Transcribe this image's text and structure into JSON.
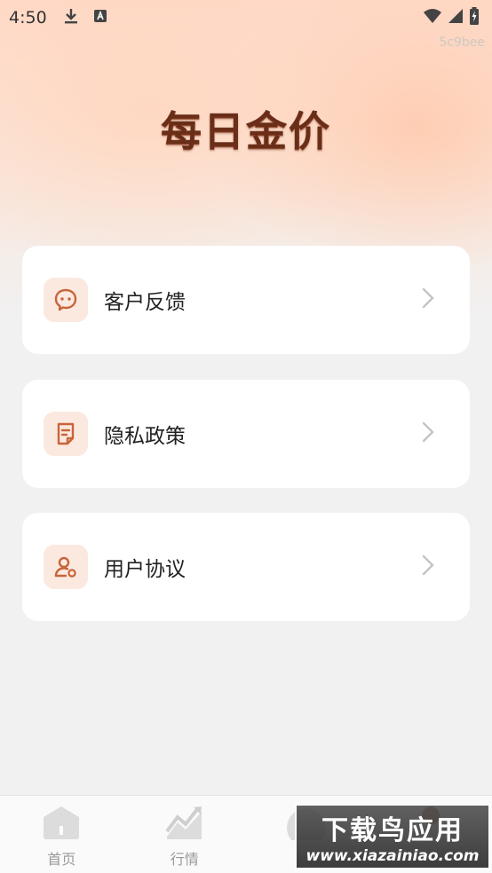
{
  "status_bar": {
    "time": "4:50",
    "left_icons": [
      "download-icon",
      "a-badge-icon"
    ],
    "right_icons": [
      "wifi-icon",
      "signal-icon",
      "battery-charging-icon"
    ]
  },
  "hash_label": "5c9bee",
  "app_title": "每日金价",
  "menu": {
    "items": [
      {
        "label": "客户反馈",
        "icon": "chat-bubble-icon"
      },
      {
        "label": "隐私政策",
        "icon": "document-icon"
      },
      {
        "label": "用户协议",
        "icon": "user-settings-icon"
      }
    ]
  },
  "tabbar": {
    "tabs": [
      {
        "label": "首页",
        "icon": "home-icon"
      },
      {
        "label": "行情",
        "icon": "chart-icon"
      },
      {
        "label": "",
        "icon": "tab3-icon"
      },
      {
        "label": "",
        "icon": "profile-icon"
      }
    ]
  },
  "watermark": {
    "title": "下载鸟应用",
    "url": "www.xiazainiao.com"
  },
  "colors": {
    "accent": "#c8643a",
    "icon_bg": "#fbe9e0",
    "title": "#6a2e18"
  }
}
